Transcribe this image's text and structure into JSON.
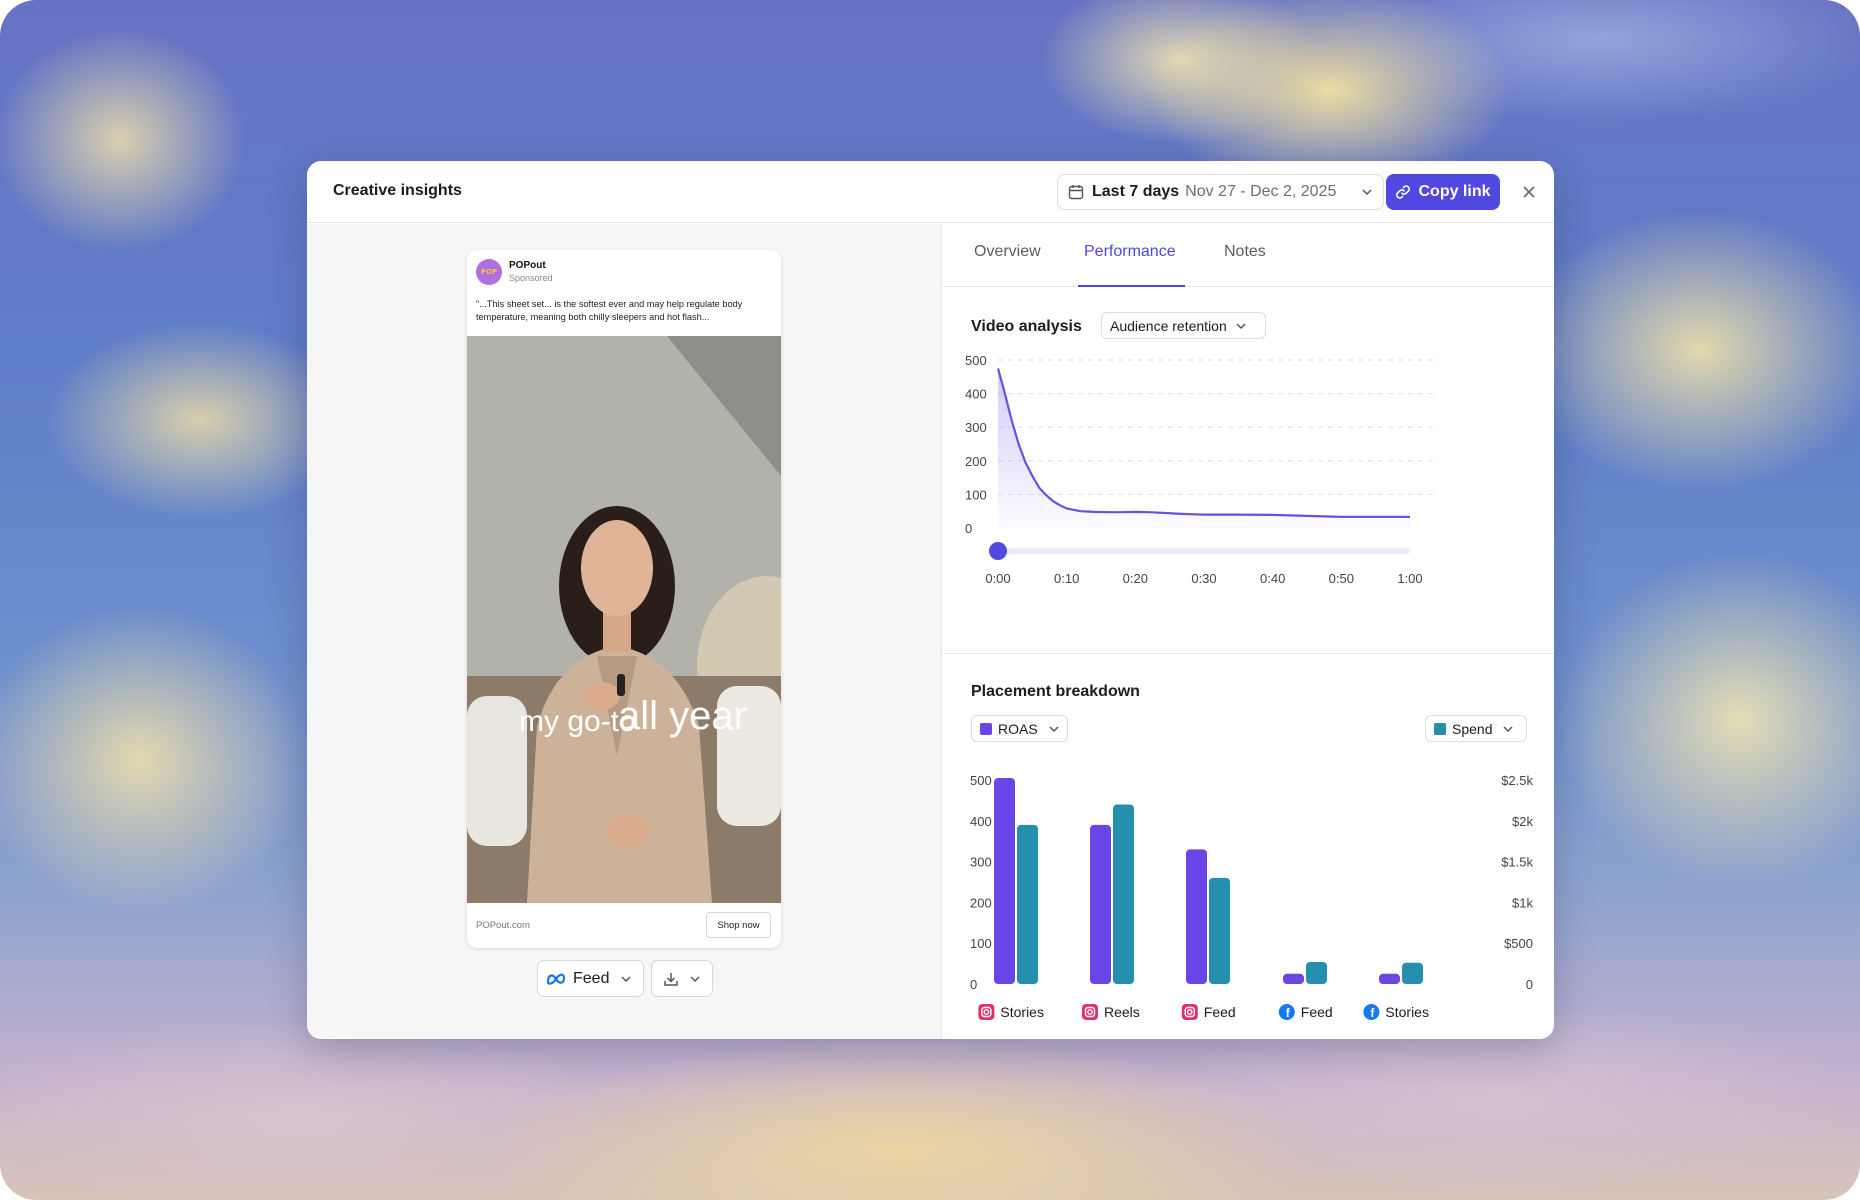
{
  "modal": {
    "title": "Creative insights",
    "date_range": {
      "label": "Last 7 days",
      "dates": "Nov 27 - Dec 2, 2025"
    },
    "copy_link_label": "Copy link"
  },
  "ad_preview": {
    "brand": "POPout",
    "avatar_text": "POP",
    "sponsored": "Sponsored",
    "caption": "\"...This sheet set... is the softest ever and may help regulate body temperature, meaning both chilly sleepers and hot flash...",
    "overlay_text": {
      "part1": "my go-to",
      "part2": "all year"
    },
    "url": "POPout.com",
    "cta": "Shop now",
    "placement_select": "Feed"
  },
  "tabs": [
    {
      "label": "Overview",
      "active": false
    },
    {
      "label": "Performance",
      "active": true
    },
    {
      "label": "Notes",
      "active": false
    }
  ],
  "video_analysis": {
    "title": "Video analysis",
    "metric_select": "Audience retention"
  },
  "placement_breakdown": {
    "title": "Placement breakdown",
    "left_metric": "ROAS",
    "right_metric": "Spend"
  },
  "colors": {
    "accent": "#5148e0",
    "roas": "#6b46e6",
    "spend": "#2590ad",
    "retention_line": "#6b4ee6"
  },
  "chart_data": [
    {
      "type": "area",
      "x_ticks": [
        "0:00",
        "0:10",
        "0:20",
        "0:30",
        "0:40",
        "0:50",
        "1:00"
      ],
      "y_ticks": [
        "500",
        "400",
        "300",
        "200",
        "100",
        "0"
      ],
      "ylim": [
        0,
        500
      ],
      "xlim_seconds": [
        0,
        60
      ],
      "grid": true,
      "playhead_seconds": 0,
      "points": [
        [
          0,
          475
        ],
        [
          1,
          400
        ],
        [
          2,
          320
        ],
        [
          3,
          250
        ],
        [
          4,
          195
        ],
        [
          5,
          155
        ],
        [
          6,
          120
        ],
        [
          7,
          98
        ],
        [
          8,
          80
        ],
        [
          9,
          68
        ],
        [
          10,
          58
        ],
        [
          12,
          50
        ],
        [
          14,
          48
        ],
        [
          16,
          47
        ],
        [
          18,
          47
        ],
        [
          20,
          48
        ],
        [
          22,
          47
        ],
        [
          24,
          45
        ],
        [
          26,
          43
        ],
        [
          28,
          41
        ],
        [
          30,
          40
        ],
        [
          35,
          40
        ],
        [
          40,
          39
        ],
        [
          45,
          36
        ],
        [
          50,
          33
        ],
        [
          55,
          33
        ],
        [
          60,
          33
        ]
      ]
    },
    {
      "type": "bar",
      "categories": [
        {
          "label": "Stories",
          "platform": "instagram"
        },
        {
          "label": "Reels",
          "platform": "instagram"
        },
        {
          "label": "Feed",
          "platform": "instagram"
        },
        {
          "label": "Feed",
          "platform": "facebook"
        },
        {
          "label": "Stories",
          "platform": "facebook"
        }
      ],
      "series": [
        {
          "name": "ROAS",
          "axis": "left",
          "values": [
            505,
            390,
            330,
            25,
            25
          ]
        },
        {
          "name": "Spend",
          "axis": "right",
          "values": [
            1950,
            2200,
            1300,
            270,
            260
          ]
        }
      ],
      "left_ticks": [
        "500",
        "400",
        "300",
        "200",
        "100",
        "0"
      ],
      "right_ticks": [
        "$2.5k",
        "$2k",
        "$1.5k",
        "$1k",
        "$500",
        "0"
      ],
      "ylim_left": [
        0,
        500
      ],
      "ylim_right": [
        0,
        2500
      ]
    }
  ]
}
